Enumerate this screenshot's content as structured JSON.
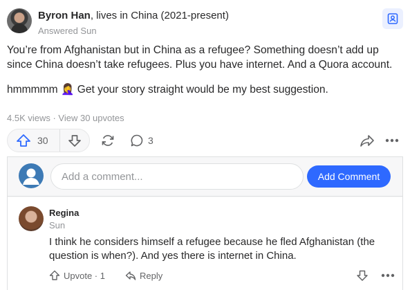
{
  "answer": {
    "author_name": "Byron Han",
    "author_credential": ", lives in China (2021-present)",
    "answered": "Answered Sun",
    "paragraph_1": "You’re from Afghanistan but in China as a refugee? Something doesn’t add up since China doesn’t take refugees. Plus you have internet. And a Quora account.",
    "paragraph_2": "hmmmmm 🤦‍♀️ Get your story straight would be my best suggestion.",
    "stats": "4.5K views · View 30 upvotes"
  },
  "actions": {
    "upvote_count": "30",
    "comment_count": "3"
  },
  "comment_box": {
    "placeholder": "Add a comment...",
    "add_label": "Add Comment"
  },
  "comments": [
    {
      "name": "Regina",
      "time": "Sun",
      "text": "I think he considers himself a refugee because he fled Afghanistan (the question is when?). And yes there is internet in China.",
      "upvote_label": "Upvote · 1",
      "reply_label": "Reply"
    }
  ],
  "colors": {
    "accent": "#2e69ff",
    "muted_text": "#939598",
    "panel_bg": "#f7f7f8"
  }
}
